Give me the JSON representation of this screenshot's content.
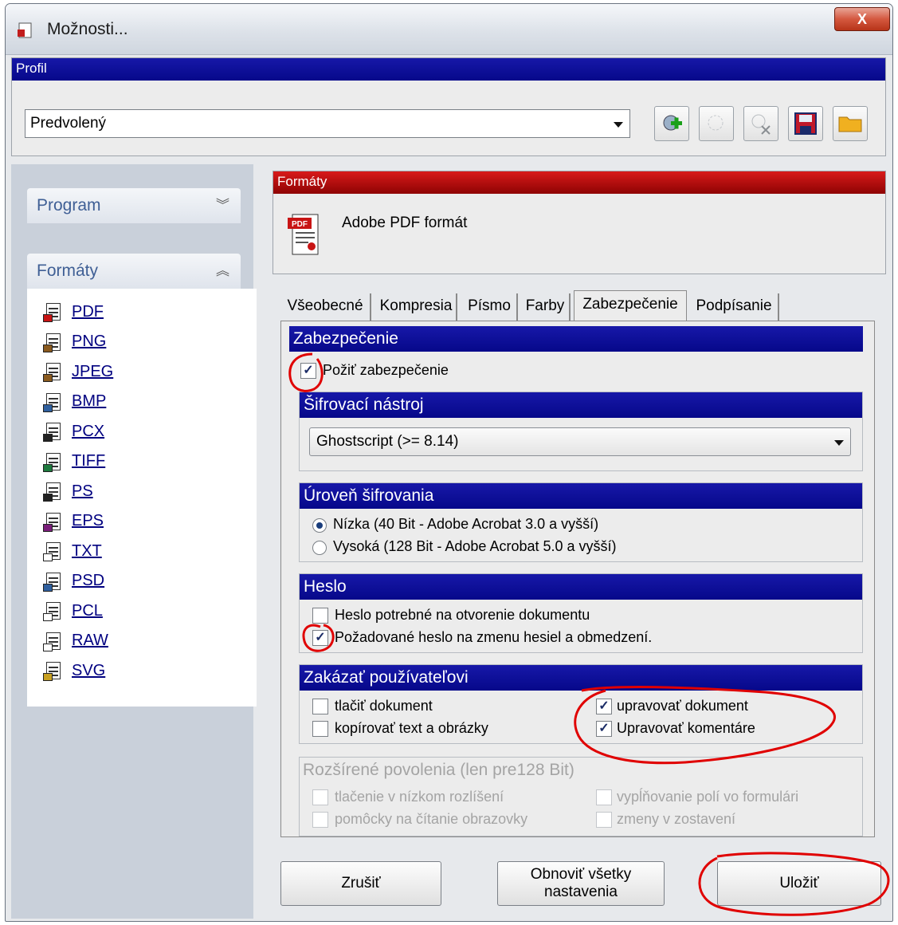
{
  "window": {
    "title": "Možnosti...",
    "close_label": "X"
  },
  "profile": {
    "header": "Profil",
    "selected": "Predvolený",
    "tools": [
      "add-profile-icon",
      "rename-profile-icon",
      "delete-profile-icon",
      "save-profile-icon",
      "open-profile-icon"
    ]
  },
  "sidebar": {
    "program_label": "Program",
    "formats_label": "Formáty",
    "formats": [
      {
        "label": "PDF",
        "color": "#c81414"
      },
      {
        "label": "PNG",
        "color": "#8a5a1e"
      },
      {
        "label": "JPEG",
        "color": "#8a5a1e"
      },
      {
        "label": "BMP",
        "color": "#2f5f9e"
      },
      {
        "label": "PCX",
        "color": "#222222"
      },
      {
        "label": "TIFF",
        "color": "#1e7a3e"
      },
      {
        "label": "PS",
        "color": "#222222"
      },
      {
        "label": "EPS",
        "color": "#7a1e7a"
      },
      {
        "label": "TXT",
        "color": "#ffffff"
      },
      {
        "label": "PSD",
        "color": "#2f5f9e"
      },
      {
        "label": "PCL",
        "color": "#ffffff"
      },
      {
        "label": "RAW",
        "color": "#ffffff"
      },
      {
        "label": "SVG",
        "color": "#c8a020"
      }
    ]
  },
  "format_panel": {
    "header": "Formáty",
    "description": "Adobe PDF formát",
    "icon_text": "PDF"
  },
  "tabs": [
    "Všeobecné",
    "Kompresia",
    "Písmo",
    "Farby",
    "Zabezpečenie",
    "Podpísanie"
  ],
  "active_tab": "Zabezpečenie",
  "security": {
    "header": "Zabezpečenie",
    "use_security": {
      "label": "Požiť zabezpečenie",
      "checked": true
    },
    "cipher": {
      "header": "Šifrovací nástroj",
      "selected": "Ghostscript (>= 8.14)"
    },
    "level": {
      "header": "Úroveň šifrovania",
      "low": {
        "label": "Nízka (40 Bit - Adobe Acrobat 3.0 a vyšší)",
        "checked": true
      },
      "high": {
        "label": "Vysoká (128 Bit - Adobe Acrobat 5.0 a vyšší)",
        "checked": false
      }
    },
    "password": {
      "header": "Heslo",
      "open": {
        "label": "Heslo potrebné na otvorenie dokumentu",
        "checked": false
      },
      "change": {
        "label": "Požadované heslo na zmenu hesiel a obmedzení.",
        "checked": true
      }
    },
    "disallow": {
      "header": "Zakázať používateľovi",
      "print": {
        "label": "tlačiť dokument",
        "checked": false
      },
      "copy": {
        "label": "kopírovať text a obrázky",
        "checked": false
      },
      "edit": {
        "label": "upravovať dokument",
        "checked": true
      },
      "comments": {
        "label": "Upravovať komentáre",
        "checked": true
      }
    },
    "extended": {
      "header": "Rozšírené povolenia (len pre128 Bit)",
      "lowres": {
        "label": "tlačenie v nízkom rozlíšení"
      },
      "reader": {
        "label": "pomôcky na čítanie obrazovky"
      },
      "forms": {
        "label": "vypĺňovanie polí vo formulári"
      },
      "assembly": {
        "label": "zmeny v zostavení"
      }
    }
  },
  "buttons": {
    "cancel": "Zrušiť",
    "reset_line1": "Obnoviť všetky",
    "reset_line2": "nastavenia",
    "save": "Uložiť"
  },
  "check_glyph": "✓",
  "colors": {
    "accent_blue": "#06088a",
    "accent_red": "#b00606",
    "annotation": "#e00000"
  }
}
